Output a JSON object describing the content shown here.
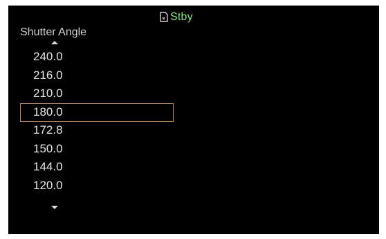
{
  "status": {
    "icon": "card-icon",
    "text": "Stby",
    "color": "#8fe08a"
  },
  "menu": {
    "title": "Shutter Angle",
    "scroll_up_icon": "arrow-up-icon",
    "scroll_down_icon": "arrow-down-icon",
    "selected_index": 3,
    "selection_color": "#b7895a",
    "options": [
      {
        "label": "240.0"
      },
      {
        "label": "216.0"
      },
      {
        "label": "210.0"
      },
      {
        "label": "180.0"
      },
      {
        "label": "172.8"
      },
      {
        "label": "150.0"
      },
      {
        "label": "144.0"
      },
      {
        "label": "120.0"
      }
    ]
  }
}
